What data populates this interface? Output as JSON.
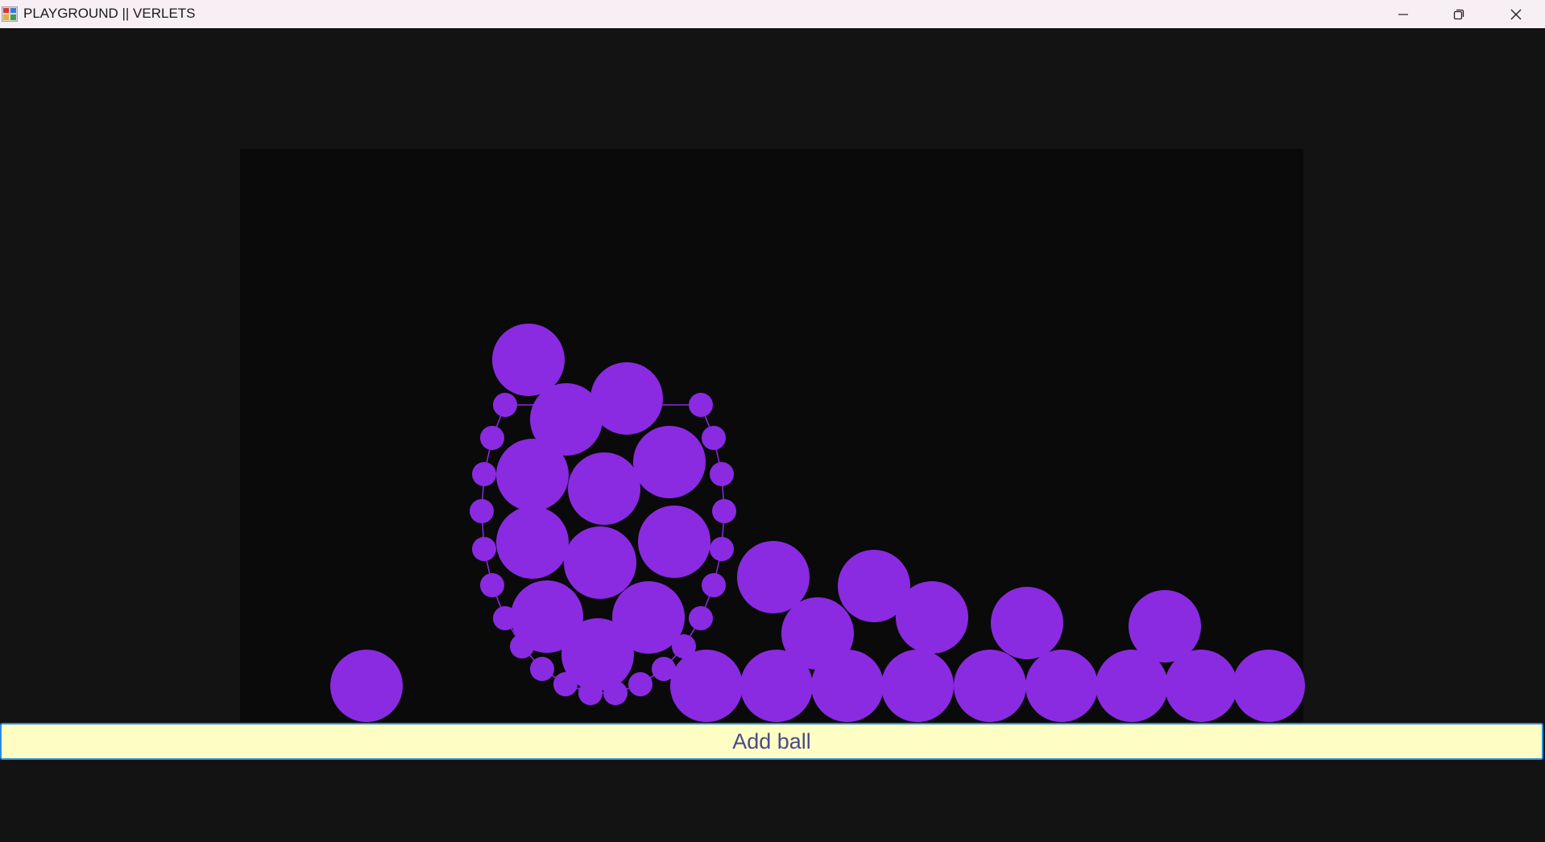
{
  "window": {
    "title": "PLAYGROUND || VERLETS",
    "icons": {
      "app": "app-icon",
      "minimize": "minimize-icon",
      "maximize": "restore-icon",
      "close": "close-icon"
    }
  },
  "simulation": {
    "ball_color": "#8a2be2",
    "background_color": "#0a0a0a"
  },
  "controls": {
    "add_ball_label": "Add ball",
    "button_color": "#fefec4"
  }
}
